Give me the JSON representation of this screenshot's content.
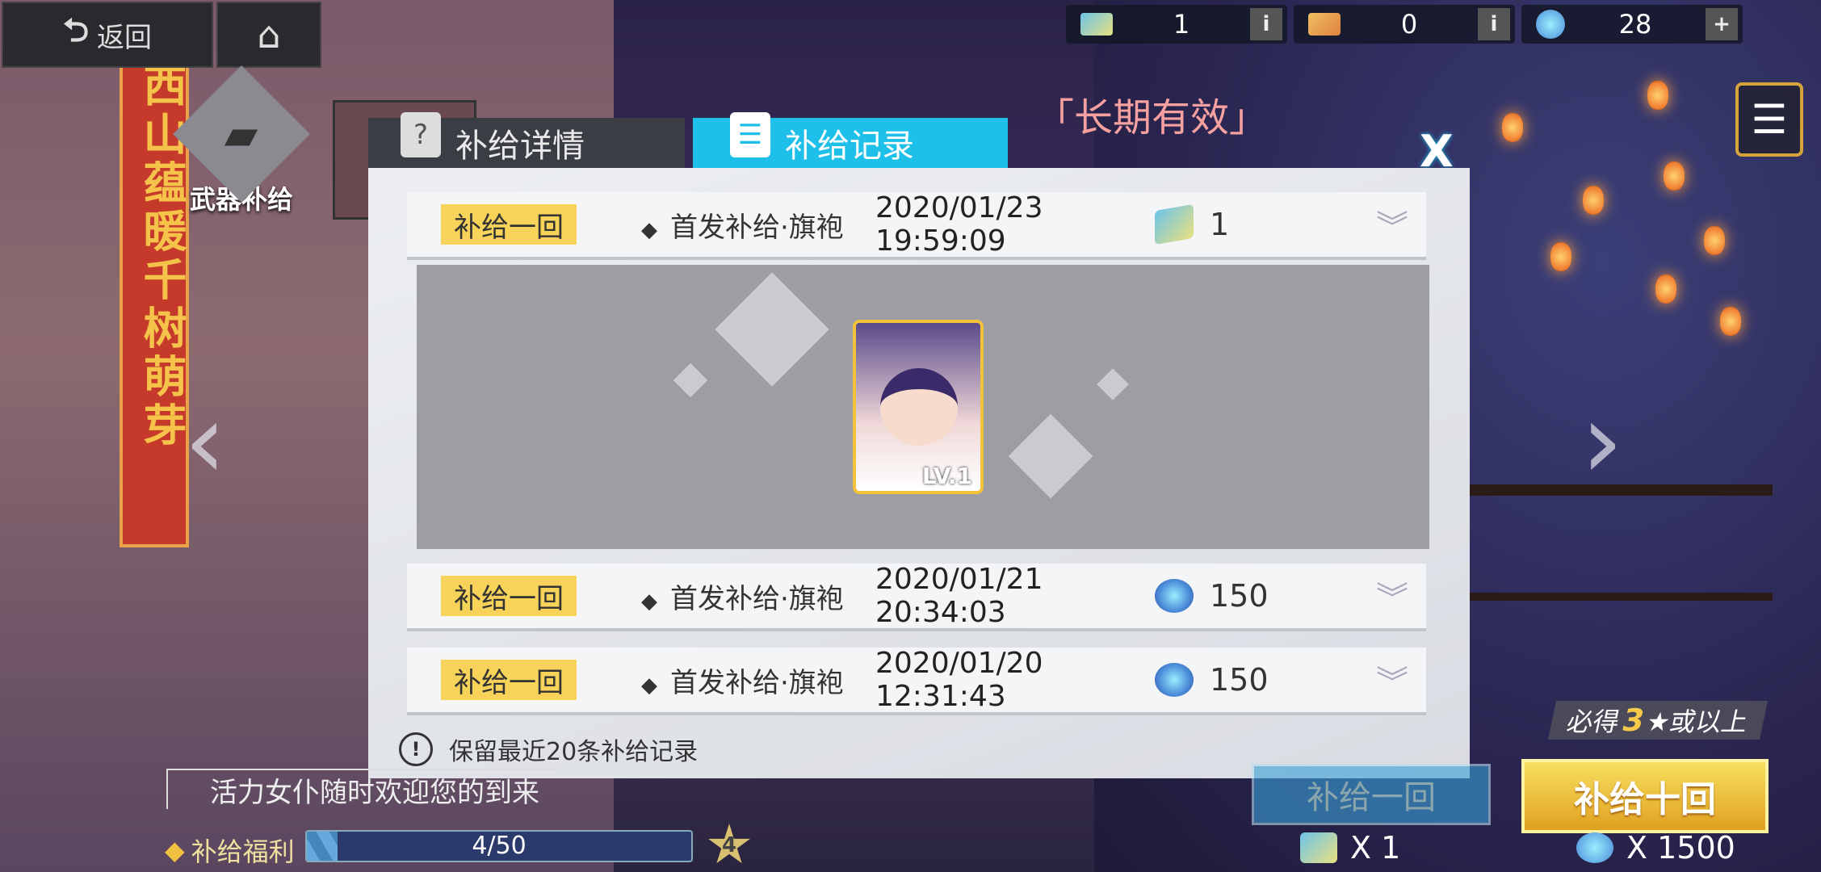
{
  "nav": {
    "back_label": "返回",
    "back_icon": "back-arrow-icon",
    "home_icon": "home-icon"
  },
  "currencies": [
    {
      "icon": "ticket-blue-icon",
      "value": "1",
      "action": "i"
    },
    {
      "icon": "ticket-gold-icon",
      "value": "0",
      "action": "i"
    },
    {
      "icon": "crystal-icon",
      "value": "28",
      "action": "+"
    }
  ],
  "banner": {
    "text": "西山蕴暖千树萌芽"
  },
  "weapon_tab": {
    "label": "武器补给"
  },
  "long_valid": "「长期有效」",
  "dialog": {
    "tab_detail": "补给详情",
    "tab_record": "补给记录",
    "close": "X",
    "records": [
      {
        "tag": "补给一回",
        "name": "首发补给·旗袍",
        "time": "2020/01/23 19:59:09",
        "reward_icon": "ticket",
        "reward": "1",
        "expanded": true
      },
      {
        "tag": "补给一回",
        "name": "首发补给·旗袍",
        "time": "2020/01/21 20:34:03",
        "reward_icon": "crystal",
        "reward": "150",
        "expanded": false
      },
      {
        "tag": "补给一回",
        "name": "首发补给·旗袍",
        "time": "2020/01/20 12:31:43",
        "reward_icon": "crystal",
        "reward": "150",
        "expanded": false
      }
    ],
    "card": {
      "level": "LV.1"
    },
    "note": "保留最近20条补给记录"
  },
  "bottom": {
    "marquee": "活力女仆随时欢迎您的到来",
    "welfare_label": "补给福利",
    "progress_text": "4/50",
    "progress_value": 0.08,
    "star_badge": "4",
    "guarantee_prefix": "必得",
    "guarantee_num": "3",
    "guarantee_suffix": "★或以上",
    "btn_one": "补给一回",
    "btn_ten": "补给十回",
    "cost_one": "X 1",
    "cost_ten": "X 1500"
  },
  "colors": {
    "accent": "#1ec0ea",
    "tag": "#f7d35a",
    "gold": "#f2c23a"
  }
}
